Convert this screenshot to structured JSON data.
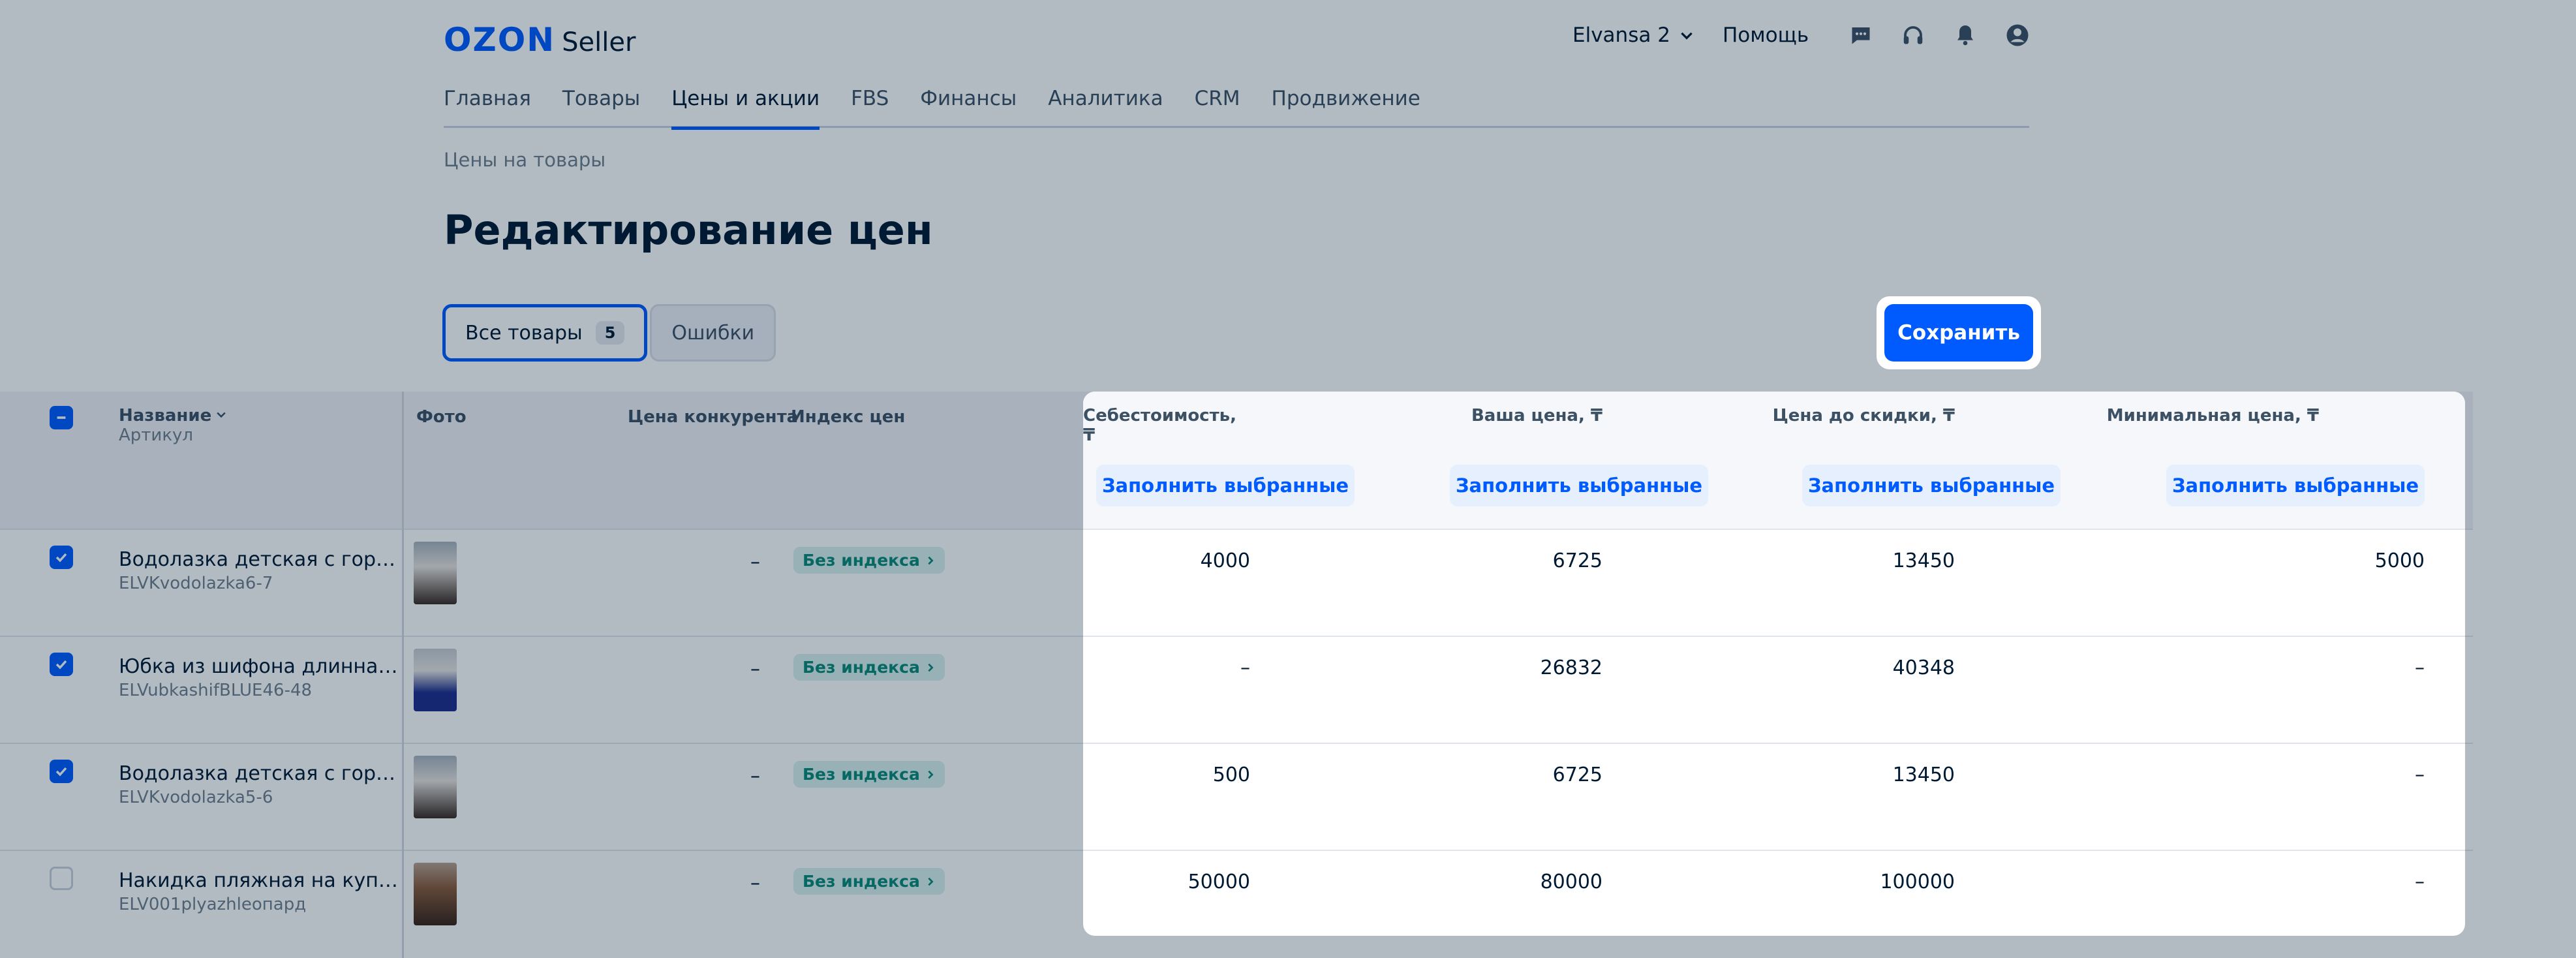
{
  "header": {
    "logo_ozon": "OZON",
    "logo_seller": "Seller",
    "account": "Elvansa 2",
    "help": "Помощь",
    "icons": [
      "chat-icon",
      "headset-icon",
      "bell-icon",
      "profile-icon"
    ]
  },
  "nav": [
    "Главная",
    "Товары",
    "Цены и акции",
    "FBS",
    "Финансы",
    "Аналитика",
    "CRM",
    "Продвижение"
  ],
  "nav_active": "Цены и акции",
  "breadcrumb": "Цены на товары",
  "page_title": "Редактирование цен",
  "filters": {
    "all_label": "Все товары",
    "all_count": "5",
    "errors_label": "Ошибки"
  },
  "save_label": "Сохранить",
  "table": {
    "headers": {
      "name": "Название",
      "sku": "Артикул",
      "photo": "Фото",
      "competitor": "Цена конкурента",
      "index": "Индекс цен",
      "cost": "Себестоимость, ₸",
      "your_price": "Ваша цена, ₸",
      "before_discount": "Цена до скидки, ₸",
      "min_price": "Минимальная цена, ₸"
    },
    "fill_label": "Заполнить выбранные",
    "rows": [
      {
        "name": "Водолазка детская с горлом",
        "sku": "ELVKvodolazka6-7",
        "competitor": "–",
        "index": "Без индекса",
        "cost": "4000",
        "price": "6725",
        "before": "13450",
        "min": "5000",
        "checked": true
      },
      {
        "name": "Юбка из шифона длинная с...",
        "sku": "ELVubkashifBLUE46-48",
        "competitor": "–",
        "index": "Без индекса",
        "cost": "–",
        "price": "26832",
        "before": "40348",
        "min": "–",
        "checked": true
      },
      {
        "name": "Водолазка детская с горлом",
        "sku": "ELVKvodolazka5-6",
        "competitor": "–",
        "index": "Без индекса",
        "cost": "500",
        "price": "6725",
        "before": "13450",
        "min": "–",
        "checked": true
      },
      {
        "name": "Накидка пляжная на купал...",
        "sku": "ELV001plyazhleопард",
        "competitor": "–",
        "index": "Без индекса",
        "cost": "50000",
        "price": "80000",
        "before": "100000",
        "min": "–",
        "checked": false
      }
    ]
  },
  "colors": {
    "brand": "#005bff",
    "index_badge": "#0a8a78"
  }
}
